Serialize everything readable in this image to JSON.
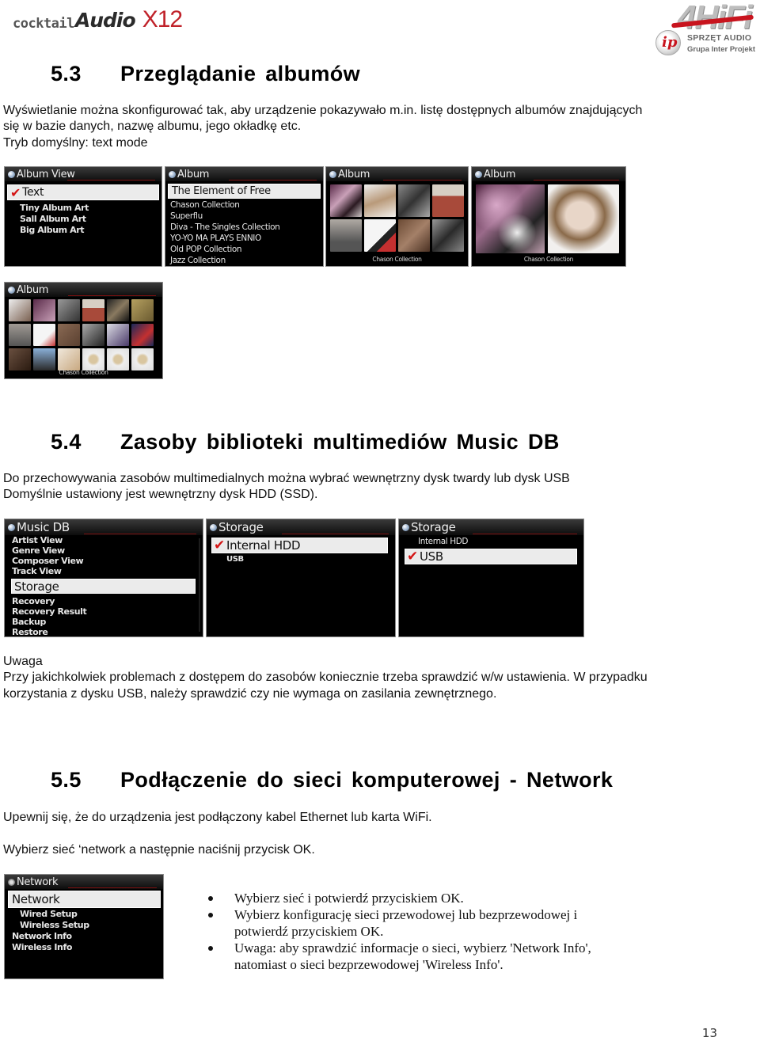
{
  "header": {
    "brand_logo": {
      "part1": "cocktail",
      "part2": "Audio",
      "part3": "X12"
    },
    "partner_logo": {
      "mark": "4HiFi",
      "badge": "ip",
      "line1": "SPRZĘT AUDIO",
      "line2": "Grupa Inter Projekt"
    }
  },
  "sections": [
    {
      "number": "5.3",
      "title": "Przeglądanie albumów",
      "paragraphs": [
        "Wyświetlanie można skonfigurować tak, aby urządzenie pokazywało m.in. listę dostępnych albumów znajdujących",
        "się w bazie danych, nazwę albumu, jego okładkę etc.",
        "Tryb domyślny: text mode"
      ],
      "screens": [
        {
          "title": "Album View",
          "selected": "Text",
          "selected_checked": true,
          "items": [
            "Tiny Album Art",
            "Sall Album Art",
            "Big Album Art"
          ]
        },
        {
          "title": "Album",
          "selected": "The Element of Free",
          "selected_checked": false,
          "items": [
            "Chason Collection",
            "Superflu",
            "Diva - The Singles Collection",
            "YO-YO MA PLAYS ENNIO",
            "Old POP Collection",
            "Jazz Collection"
          ]
        },
        {
          "title": "Album",
          "caption": "Chason Collection",
          "view": "Tiny Album Art (4x2 grid)"
        },
        {
          "title": "Album",
          "caption": "Chason Collection",
          "view": "Big Album Art (2 covers)"
        },
        {
          "title": "Album",
          "caption": "Chason Collection",
          "view": "Small Album Art (6x3 grid)"
        }
      ]
    },
    {
      "number": "5.4",
      "title": "Zasoby biblioteki multimediów Music DB",
      "paragraphs": [
        "Do przechowywania zasobów multimedialnych można wybrać wewnętrzny dysk twardy lub dysk USB",
        "Domyślnie ustawiony jest wewnętrzny dysk HDD (SSD)."
      ],
      "screens": [
        {
          "title": "Music DB",
          "items_before": [
            "Artist View",
            "Genre View",
            "Composer View",
            "Track View"
          ],
          "selected": "Storage",
          "items_after": [
            "Recovery",
            "Recovery Result",
            "Backup",
            "Restore"
          ]
        },
        {
          "title": "Storage",
          "items": [
            "Internal HDD",
            "USB"
          ],
          "checked": "Internal HDD"
        },
        {
          "title": "Storage",
          "items": [
            "Internal HDD",
            "USB"
          ],
          "checked": "USB"
        }
      ],
      "note": {
        "heading": "Uwaga",
        "lines": [
          "Przy jakichkolwiek problemach z dostępem do zasobów koniecznie trzeba sprawdzić w/w ustawienia. W przypadku",
          "korzystania z dysku USB, należy sprawdzić czy nie wymaga on zasilania zewnętrznego."
        ]
      }
    },
    {
      "number": "5.5",
      "title": "Podłączenie do sieci komputerowej - Network",
      "paragraphs": [
        "Upewnij się, że do urządzenia jest podłączony kabel Ethernet lub karta WiFi.",
        "Wybierz sieć ‘network a następnie naciśnij przycisk OK."
      ],
      "screen": {
        "title": "Network",
        "selected": "Network",
        "sub_items": [
          "Wired Setup",
          "Wireless Setup"
        ],
        "items": [
          "Network Info",
          "Wireless Info"
        ]
      },
      "bullets": [
        [
          "Wybierz sieć i potwierdź przyciskiem OK."
        ],
        [
          "Wybierz konfigurację sieci przewodowej lub bezprzewodowej i",
          "potwierdź przyciskiem OK."
        ],
        [
          "Uwaga: aby sprawdzić informacje o sieci, wybierz 'Network Info',",
          "natomiast o sieci bezprzewodowej 'Wireless Info'."
        ]
      ]
    }
  ],
  "page_number": "13",
  "colors": {
    "check": "#d41414",
    "brand_red": "#c0222a",
    "screen_bg": "#000000",
    "highlight": "#ebebeb"
  }
}
